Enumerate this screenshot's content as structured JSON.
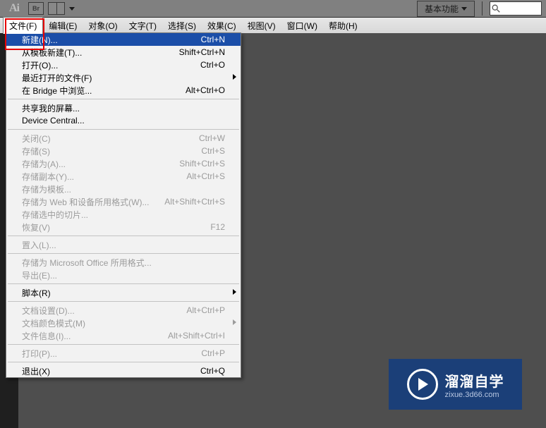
{
  "topbar": {
    "app": "Ai",
    "br": "Br",
    "basic": "基本功能"
  },
  "menubar": [
    {
      "label": "文件(F)",
      "open": true
    },
    {
      "label": "编辑(E)"
    },
    {
      "label": "对象(O)"
    },
    {
      "label": "文字(T)"
    },
    {
      "label": "选择(S)"
    },
    {
      "label": "效果(C)"
    },
    {
      "label": "视图(V)"
    },
    {
      "label": "窗口(W)"
    },
    {
      "label": "帮助(H)"
    }
  ],
  "menu": {
    "groups": [
      [
        {
          "label": "新建(N)...",
          "shortcut": "Ctrl+N",
          "hl": true
        },
        {
          "label": "从模板新建(T)...",
          "shortcut": "Shift+Ctrl+N"
        },
        {
          "label": "打开(O)...",
          "shortcut": "Ctrl+O"
        },
        {
          "label": "最近打开的文件(F)",
          "sub": true
        },
        {
          "label": "在 Bridge 中浏览...",
          "shortcut": "Alt+Ctrl+O"
        }
      ],
      [
        {
          "label": "共享我的屏幕..."
        },
        {
          "label": "Device Central..."
        }
      ],
      [
        {
          "label": "关闭(C)",
          "shortcut": "Ctrl+W",
          "dis": true
        },
        {
          "label": "存储(S)",
          "shortcut": "Ctrl+S",
          "dis": true
        },
        {
          "label": "存储为(A)...",
          "shortcut": "Shift+Ctrl+S",
          "dis": true
        },
        {
          "label": "存储副本(Y)...",
          "shortcut": "Alt+Ctrl+S",
          "dis": true
        },
        {
          "label": "存储为模板...",
          "dis": true
        },
        {
          "label": "存储为 Web 和设备所用格式(W)...",
          "shortcut": "Alt+Shift+Ctrl+S",
          "dis": true
        },
        {
          "label": "存储选中的切片...",
          "dis": true
        },
        {
          "label": "恢复(V)",
          "shortcut": "F12",
          "dis": true
        }
      ],
      [
        {
          "label": "置入(L)...",
          "dis": true
        }
      ],
      [
        {
          "label": "存储为 Microsoft Office 所用格式...",
          "dis": true
        },
        {
          "label": "导出(E)...",
          "dis": true
        }
      ],
      [
        {
          "label": "脚本(R)",
          "sub": true
        }
      ],
      [
        {
          "label": "文档设置(D)...",
          "shortcut": "Alt+Ctrl+P",
          "dis": true
        },
        {
          "label": "文档颜色模式(M)",
          "sub": true,
          "dis": true
        },
        {
          "label": "文件信息(I)...",
          "shortcut": "Alt+Shift+Ctrl+I",
          "dis": true
        }
      ],
      [
        {
          "label": "打印(P)...",
          "shortcut": "Ctrl+P",
          "dis": true
        }
      ],
      [
        {
          "label": "退出(X)",
          "shortcut": "Ctrl+Q"
        }
      ]
    ]
  },
  "watermark": {
    "title": "溜溜自学",
    "url": "zixue.3d66.com"
  }
}
